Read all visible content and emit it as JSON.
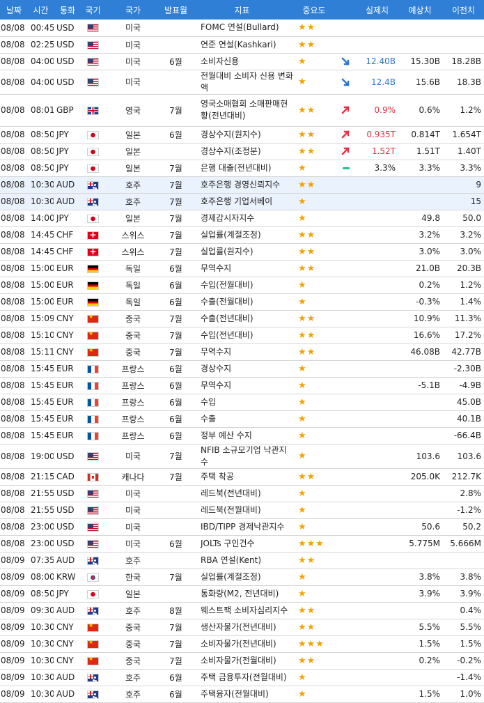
{
  "headers": {
    "date": "날짜",
    "time": "시간",
    "currency": "통화",
    "flag": "국기",
    "country": "국가",
    "period": "발표월",
    "indicator": "지표",
    "importance": "중요도",
    "actual": "실제치",
    "forecast": "예상치",
    "previous": "이전치"
  },
  "rows": [
    {
      "date": "08/08",
      "time": "00:45",
      "cur": "USD",
      "flag": "us-flag",
      "country": "미국",
      "period": "",
      "indicator": "FOMC 연설(Bullard)",
      "stars": "★★",
      "arrow": "",
      "actual": "",
      "forecast": "",
      "previous": ""
    },
    {
      "date": "08/08",
      "time": "02:25",
      "cur": "USD",
      "flag": "us-flag",
      "country": "미국",
      "period": "",
      "indicator": "연준 연설(Kashkari)",
      "stars": "★★",
      "arrow": "",
      "actual": "",
      "forecast": "",
      "previous": ""
    },
    {
      "date": "08/08",
      "time": "04:00",
      "cur": "USD",
      "flag": "us-flag",
      "country": "미국",
      "period": "6월",
      "indicator": "소비자신용",
      "stars": "★",
      "arrow": "down",
      "actual": "12.40B",
      "forecast": "15.30B",
      "previous": "18.28B"
    },
    {
      "date": "08/08",
      "time": "04:00",
      "cur": "USD",
      "flag": "us-flag",
      "country": "미국",
      "period": "",
      "indicator": "전월대비 소비자 신용 변화액",
      "stars": "★",
      "arrow": "down",
      "actual": "12.4B",
      "forecast": "15.6B",
      "previous": "18.3B"
    },
    {
      "date": "08/08",
      "time": "08:01",
      "cur": "GBP",
      "flag": "gb-flag",
      "country": "영국",
      "period": "7월",
      "indicator": "영국소매협회 소매판매현황(전년대비)",
      "stars": "★★",
      "arrow": "up",
      "actual": "0.9%",
      "forecast": "0.6%",
      "previous": "1.2%"
    },
    {
      "date": "08/08",
      "time": "08:50",
      "cur": "JPY",
      "flag": "jp-flag",
      "country": "일본",
      "period": "6월",
      "indicator": "경상수지(원지수)",
      "stars": "★★",
      "arrow": "up",
      "actual": "0.935T",
      "forecast": "0.814T",
      "previous": "1.654T"
    },
    {
      "date": "08/08",
      "time": "08:50",
      "cur": "JPY",
      "flag": "jp-flag",
      "country": "일본",
      "period": "",
      "indicator": "경상수지(조정분)",
      "stars": "★★",
      "arrow": "up",
      "actual": "1.52T",
      "forecast": "1.51T",
      "previous": "1.40T"
    },
    {
      "date": "08/08",
      "time": "08:50",
      "cur": "JPY",
      "flag": "jp-flag",
      "country": "일본",
      "period": "7월",
      "indicator": "은행 대출(전년대비)",
      "stars": "★",
      "arrow": "flat",
      "actual": "3.3%",
      "forecast": "3.3%",
      "previous": "3.3%"
    },
    {
      "date": "08/08",
      "time": "10:30",
      "cur": "AUD",
      "flag": "au-flag",
      "country": "호주",
      "period": "7월",
      "indicator": "호주은행 경영신뢰지수",
      "stars": "★★",
      "arrow": "",
      "actual": "",
      "forecast": "",
      "previous": "9",
      "hl": true
    },
    {
      "date": "08/08",
      "time": "10:30",
      "cur": "AUD",
      "flag": "au-flag",
      "country": "호주",
      "period": "7월",
      "indicator": "호주은행 기업서베이",
      "stars": "★",
      "arrow": "",
      "actual": "",
      "forecast": "",
      "previous": "15",
      "hl": true
    },
    {
      "date": "08/08",
      "time": "14:00",
      "cur": "JPY",
      "flag": "jp-flag",
      "country": "일본",
      "period": "7월",
      "indicator": "경제감시자지수",
      "stars": "★",
      "arrow": "",
      "actual": "",
      "forecast": "49.8",
      "previous": "50.0"
    },
    {
      "date": "08/08",
      "time": "14:45",
      "cur": "CHF",
      "flag": "ch-flag",
      "country": "스위스",
      "period": "7월",
      "indicator": "실업률(계절조정)",
      "stars": "★★",
      "arrow": "",
      "actual": "",
      "forecast": "3.2%",
      "previous": "3.2%"
    },
    {
      "date": "08/08",
      "time": "14:45",
      "cur": "CHF",
      "flag": "ch-flag",
      "country": "스위스",
      "period": "7월",
      "indicator": "실업률(원지수)",
      "stars": "★★",
      "arrow": "",
      "actual": "",
      "forecast": "3.0%",
      "previous": "3.0%"
    },
    {
      "date": "08/08",
      "time": "15:00",
      "cur": "EUR",
      "flag": "de-flag",
      "country": "독일",
      "period": "6월",
      "indicator": "무역수지",
      "stars": "★★",
      "arrow": "",
      "actual": "",
      "forecast": "21.0B",
      "previous": "20.3B"
    },
    {
      "date": "08/08",
      "time": "15:00",
      "cur": "EUR",
      "flag": "de-flag",
      "country": "독일",
      "period": "6월",
      "indicator": "수입(전월대비)",
      "stars": "★",
      "arrow": "",
      "actual": "",
      "forecast": "0.2%",
      "previous": "1.2%"
    },
    {
      "date": "08/08",
      "time": "15:00",
      "cur": "EUR",
      "flag": "de-flag",
      "country": "독일",
      "period": "6월",
      "indicator": "수출(전월대비)",
      "stars": "★",
      "arrow": "",
      "actual": "",
      "forecast": "-0.3%",
      "previous": "1.4%"
    },
    {
      "date": "08/08",
      "time": "15:09",
      "cur": "CNY",
      "flag": "cn-flag",
      "country": "중국",
      "period": "7월",
      "indicator": "수출(전년대비)",
      "stars": "★★",
      "arrow": "",
      "actual": "",
      "forecast": "10.9%",
      "previous": "11.3%"
    },
    {
      "date": "08/08",
      "time": "15:10",
      "cur": "CNY",
      "flag": "cn-flag",
      "country": "중국",
      "period": "7월",
      "indicator": "수입(전년대비)",
      "stars": "★★",
      "arrow": "",
      "actual": "",
      "forecast": "16.6%",
      "previous": "17.2%"
    },
    {
      "date": "08/08",
      "time": "15:11",
      "cur": "CNY",
      "flag": "cn-flag",
      "country": "중국",
      "period": "7월",
      "indicator": "무역수지",
      "stars": "★★",
      "arrow": "",
      "actual": "",
      "forecast": "46.08B",
      "previous": "42.77B"
    },
    {
      "date": "08/08",
      "time": "15:45",
      "cur": "EUR",
      "flag": "fr-flag",
      "country": "프랑스",
      "period": "6월",
      "indicator": "경상수지",
      "stars": "★",
      "arrow": "",
      "actual": "",
      "forecast": "",
      "previous": "-2.30B"
    },
    {
      "date": "08/08",
      "time": "15:45",
      "cur": "EUR",
      "flag": "fr-flag",
      "country": "프랑스",
      "period": "6월",
      "indicator": "무역수지",
      "stars": "★",
      "arrow": "",
      "actual": "",
      "forecast": "-5.1B",
      "previous": "-4.9B"
    },
    {
      "date": "08/08",
      "time": "15:45",
      "cur": "EUR",
      "flag": "fr-flag",
      "country": "프랑스",
      "period": "6월",
      "indicator": "수입",
      "stars": "★",
      "arrow": "",
      "actual": "",
      "forecast": "",
      "previous": "45.0B"
    },
    {
      "date": "08/08",
      "time": "15:45",
      "cur": "EUR",
      "flag": "fr-flag",
      "country": "프랑스",
      "period": "6월",
      "indicator": "수출",
      "stars": "★",
      "arrow": "",
      "actual": "",
      "forecast": "",
      "previous": "40.1B"
    },
    {
      "date": "08/08",
      "time": "15:45",
      "cur": "EUR",
      "flag": "fr-flag",
      "country": "프랑스",
      "period": "6월",
      "indicator": "정부 예산 수지",
      "stars": "★",
      "arrow": "",
      "actual": "",
      "forecast": "",
      "previous": "-66.4B"
    },
    {
      "date": "08/08",
      "time": "19:00",
      "cur": "USD",
      "flag": "us-flag",
      "country": "미국",
      "period": "7월",
      "indicator": "NFIB 소규모기업 낙관지수",
      "stars": "★",
      "arrow": "",
      "actual": "",
      "forecast": "103.6",
      "previous": "103.6"
    },
    {
      "date": "08/08",
      "time": "21:15",
      "cur": "CAD",
      "flag": "ca-flag",
      "country": "캐나다",
      "period": "7월",
      "indicator": "주택 착공",
      "stars": "★★",
      "arrow": "",
      "actual": "",
      "forecast": "205.0K",
      "previous": "212.7K"
    },
    {
      "date": "08/08",
      "time": "21:55",
      "cur": "USD",
      "flag": "us-flag",
      "country": "미국",
      "period": "",
      "indicator": "레드북(전년대비)",
      "stars": "★",
      "arrow": "",
      "actual": "",
      "forecast": "",
      "previous": "2.8%"
    },
    {
      "date": "08/08",
      "time": "21:55",
      "cur": "USD",
      "flag": "us-flag",
      "country": "미국",
      "period": "",
      "indicator": "레드북(전월대비)",
      "stars": "★",
      "arrow": "",
      "actual": "",
      "forecast": "",
      "previous": "-1.2%"
    },
    {
      "date": "08/08",
      "time": "23:00",
      "cur": "USD",
      "flag": "us-flag",
      "country": "미국",
      "period": "",
      "indicator": "IBD/TIPP 경제낙관지수",
      "stars": "★",
      "arrow": "",
      "actual": "",
      "forecast": "50.6",
      "previous": "50.2"
    },
    {
      "date": "08/08",
      "time": "23:00",
      "cur": "USD",
      "flag": "us-flag",
      "country": "미국",
      "period": "6월",
      "indicator": "JOLTs 구인건수",
      "stars": "★★★",
      "arrow": "",
      "actual": "",
      "forecast": "5.775M",
      "previous": "5.666M"
    },
    {
      "date": "08/09",
      "time": "07:35",
      "cur": "AUD",
      "flag": "au-flag",
      "country": "호주",
      "period": "",
      "indicator": "RBA 연설(Kent)",
      "stars": "★★",
      "arrow": "",
      "actual": "",
      "forecast": "",
      "previous": ""
    },
    {
      "date": "08/09",
      "time": "08:00",
      "cur": "KRW",
      "flag": "kr-flag",
      "country": "한국",
      "period": "7월",
      "indicator": "실업률(계절조정)",
      "stars": "★",
      "arrow": "",
      "actual": "",
      "forecast": "3.8%",
      "previous": "3.8%"
    },
    {
      "date": "08/09",
      "time": "08:50",
      "cur": "JPY",
      "flag": "jp-flag",
      "country": "일본",
      "period": "",
      "indicator": "통화량(M2, 전년대비)",
      "stars": "★",
      "arrow": "",
      "actual": "",
      "forecast": "3.9%",
      "previous": "3.9%"
    },
    {
      "date": "08/09",
      "time": "09:30",
      "cur": "AUD",
      "flag": "au-flag",
      "country": "호주",
      "period": "8월",
      "indicator": "웨스트팩 소비자심리지수",
      "stars": "★★",
      "arrow": "",
      "actual": "",
      "forecast": "",
      "previous": "0.4%"
    },
    {
      "date": "08/09",
      "time": "10:30",
      "cur": "CNY",
      "flag": "cn-flag",
      "country": "중국",
      "period": "7월",
      "indicator": "생산자물가(전년대비)",
      "stars": "★★",
      "arrow": "",
      "actual": "",
      "forecast": "5.5%",
      "previous": "5.5%"
    },
    {
      "date": "08/09",
      "time": "10:30",
      "cur": "CNY",
      "flag": "cn-flag",
      "country": "중국",
      "period": "7월",
      "indicator": "소비자물가(전년대비)",
      "stars": "★★★",
      "arrow": "",
      "actual": "",
      "forecast": "1.5%",
      "previous": "1.5%"
    },
    {
      "date": "08/09",
      "time": "10:30",
      "cur": "CNY",
      "flag": "cn-flag",
      "country": "중국",
      "period": "7월",
      "indicator": "소비자물가(전월대비)",
      "stars": "★★",
      "arrow": "",
      "actual": "",
      "forecast": "0.2%",
      "previous": "-0.2%"
    },
    {
      "date": "08/09",
      "time": "10:30",
      "cur": "AUD",
      "flag": "au-flag",
      "country": "호주",
      "period": "6월",
      "indicator": "주택 금융투자(전월대비)",
      "stars": "★",
      "arrow": "",
      "actual": "",
      "forecast": "",
      "previous": "-1.4%"
    },
    {
      "date": "08/09",
      "time": "10:30",
      "cur": "AUD",
      "flag": "au-flag",
      "country": "호주",
      "period": "6월",
      "indicator": "주택융자(전월대비)",
      "stars": "★",
      "arrow": "",
      "actual": "",
      "forecast": "1.5%",
      "previous": "1.0%"
    }
  ]
}
